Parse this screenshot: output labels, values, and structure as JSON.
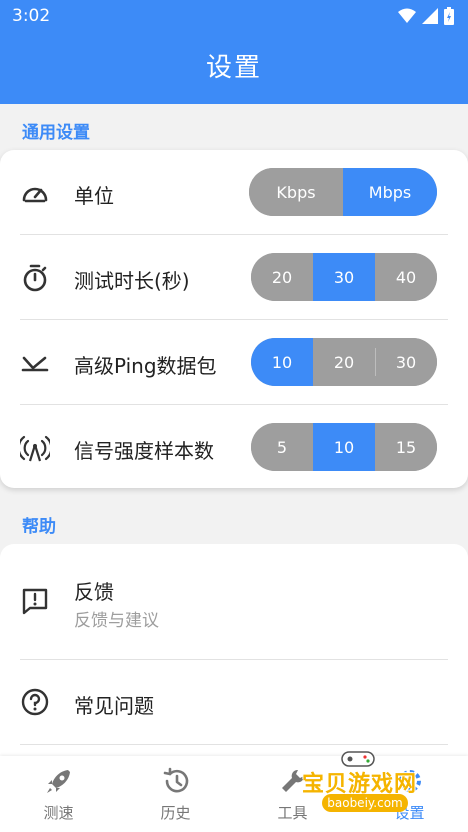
{
  "status_bar": {
    "time": "3:02",
    "icons": [
      "wifi-icon",
      "signal-icon",
      "battery-icon"
    ]
  },
  "app_bar": {
    "title": "设置"
  },
  "general": {
    "section_label": "通用设置",
    "rows": [
      {
        "label": "单位",
        "icon": "speedometer-icon",
        "options": [
          "Kbps",
          "Mbps"
        ],
        "selected": "Mbps"
      },
      {
        "label": "测试时长(秒)",
        "icon": "timer-icon",
        "options": [
          "20",
          "30",
          "40"
        ],
        "selected": "30"
      },
      {
        "label": "高级Ping数据包",
        "icon": "ping-icon",
        "options": [
          "10",
          "20",
          "30"
        ],
        "selected": "10"
      },
      {
        "label": "信号强度样本数",
        "icon": "antenna-icon",
        "options": [
          "5",
          "10",
          "15"
        ],
        "selected": "10"
      }
    ]
  },
  "help": {
    "section_label": "帮助",
    "items": [
      {
        "title": "反馈",
        "subtitle": "反馈与建议",
        "icon": "feedback-icon"
      },
      {
        "title": "常见问题",
        "icon": "help-circle-icon"
      }
    ]
  },
  "bottom_nav": {
    "items": [
      {
        "label": "测速",
        "icon": "rocket-icon"
      },
      {
        "label": "历史",
        "icon": "history-icon"
      },
      {
        "label": "工具",
        "icon": "tools-icon"
      },
      {
        "label": "设置",
        "icon": "settings-icon"
      }
    ],
    "active": "设置"
  },
  "watermark": {
    "title": "宝贝游戏网",
    "url": "baobeiy.com"
  },
  "colors": {
    "accent": "#3d8bf7",
    "segment_inactive": "#9e9e9e",
    "background": "#f2f2f2"
  }
}
